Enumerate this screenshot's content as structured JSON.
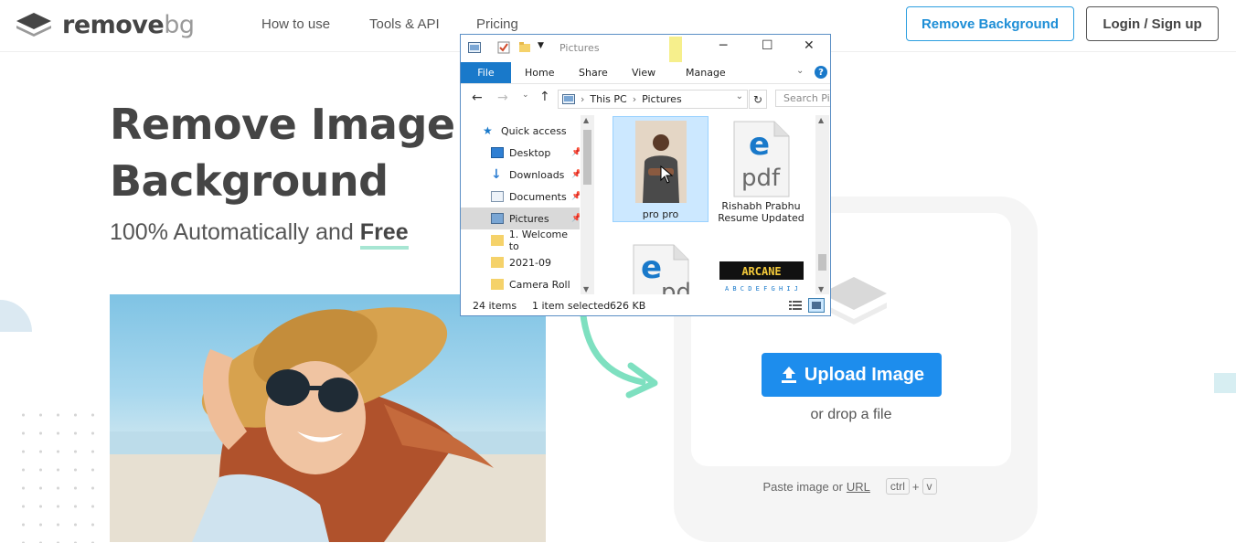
{
  "brand": {
    "name_main": "remove",
    "name_suffix": "bg"
  },
  "nav": {
    "items": [
      "How to use",
      "Tools & API",
      "Pricing"
    ]
  },
  "header": {
    "remove_bg_button": "Remove Background",
    "login_button": "Login / Sign up"
  },
  "hero": {
    "title_line1": "Remove Image",
    "title_line2": "Background",
    "subtitle_prefix": "100% Automatically and",
    "subtitle_free": "Free"
  },
  "upload": {
    "button_label": "Upload Image",
    "drop_text": "or drop a file",
    "paste_text": "Paste image or",
    "paste_link": "URL",
    "key_ctrl": "ctrl",
    "key_plus": "+",
    "key_v": "v"
  },
  "explorer": {
    "title": "Pictures",
    "ribbon_tabs": [
      "File",
      "Home",
      "Share",
      "View",
      "Manage"
    ],
    "breadcrumb": [
      "This PC",
      "Pictures"
    ],
    "search_placeholder": "Search Pi",
    "nav_items": [
      {
        "label": "Quick access",
        "icon": "star-icon"
      },
      {
        "label": "Desktop",
        "icon": "desktop-icon"
      },
      {
        "label": "Downloads",
        "icon": "download-arrow-icon"
      },
      {
        "label": "Documents",
        "icon": "documents-icon"
      },
      {
        "label": "Pictures",
        "icon": "pictures-icon"
      },
      {
        "label": "1. Welcome to",
        "icon": "folder-icon"
      },
      {
        "label": "2021-09",
        "icon": "folder-icon"
      },
      {
        "label": "Camera Roll",
        "icon": "folder-icon"
      }
    ],
    "files": [
      {
        "name": "pro pro"
      },
      {
        "name_line1": "Rishabh Prabhu",
        "name_line2": "Resume Updated",
        "type_label": "pdf"
      },
      {
        "name": "",
        "type_label": "pdf"
      },
      {
        "name": "",
        "thumb_text": "ARCANE",
        "thumb_sub": "A B C D E F G H I J"
      }
    ],
    "status": {
      "item_count": "24 items",
      "selection": "1 item selected",
      "size": "626 KB"
    }
  },
  "colors": {
    "accent_blue": "#1d8ded",
    "mint": "#7ee0c0",
    "text_dark": "#454545"
  }
}
